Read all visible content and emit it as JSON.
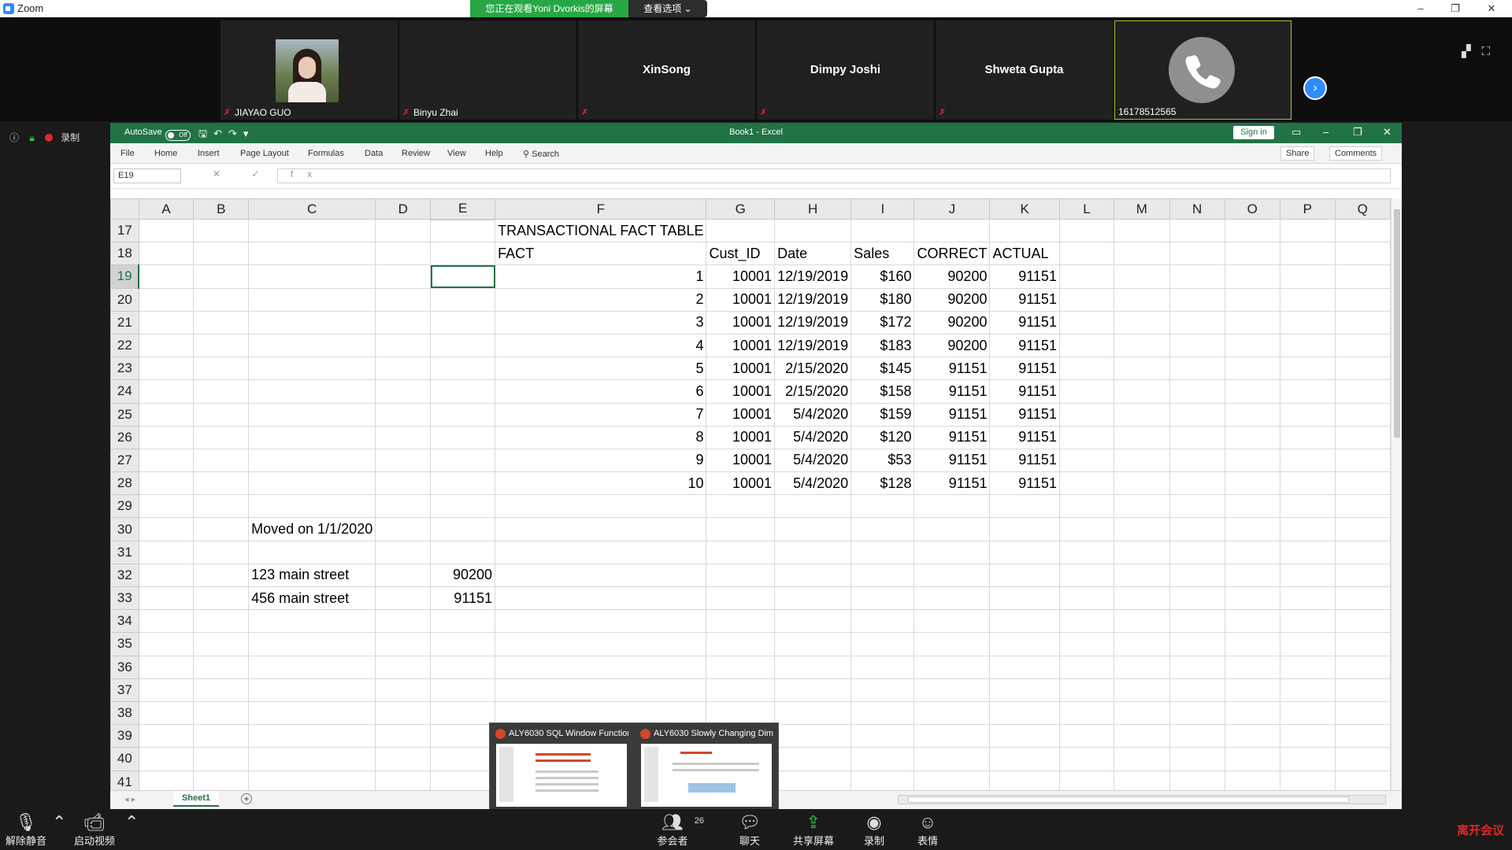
{
  "zoom": {
    "title": "Zoom",
    "share_banner": "您正在观看Yoni Dvorkis的屏幕",
    "view_options": "查看选项 ⌄",
    "win_min": "–",
    "win_restore": "❐",
    "win_close": "✕",
    "participants": [
      {
        "name": "JIAYAO GUO",
        "center_name": ""
      },
      {
        "name": "Binyu Zhai",
        "center_name": ""
      },
      {
        "name": "",
        "center_name": "XinSong"
      },
      {
        "name": "",
        "center_name": "Dimpy Joshi"
      },
      {
        "name": "",
        "center_name": "Shweta Gupta"
      },
      {
        "name": "16178512565",
        "center_name": ""
      }
    ],
    "record_label": "录制",
    "toolbar": {
      "unmute": "解除静音",
      "start_video": "启动视频",
      "participants": "参会者",
      "participant_count": "26",
      "chat": "聊天",
      "share_screen": "共享屏幕",
      "record": "录制",
      "reactions": "表情",
      "leave": "离开会议"
    }
  },
  "excel": {
    "autosave_label": "AutoSave",
    "autosave_state": "Off",
    "book_title": "Book1  -  Excel",
    "sign_in": "Sign in",
    "ribbon_tabs": [
      "File",
      "Home",
      "Insert",
      "Page Layout",
      "Formulas",
      "Data",
      "Review",
      "View",
      "Help"
    ],
    "search": "Search",
    "share": "Share",
    "comments": "Comments",
    "name_box": "E19",
    "formula_icons": "✕ ✓ fx",
    "sheet_tab": "Sheet1",
    "columns": [
      "A",
      "B",
      "C",
      "D",
      "E",
      "F",
      "G",
      "H",
      "I",
      "J",
      "K",
      "L",
      "M",
      "N",
      "O",
      "P",
      "Q"
    ],
    "selected_cell": "E19",
    "rows": [
      {
        "n": "17",
        "F": "TRANSACTIONAL FACT TABLE"
      },
      {
        "n": "18",
        "F": "FACT",
        "G": "Cust_ID",
        "H": "Date",
        "I": "Sales",
        "J": "CORRECT",
        "K": "ACTUAL"
      },
      {
        "n": "19",
        "F": "1",
        "G": "10001",
        "H": "12/19/2019",
        "I": "$160",
        "J": "90200",
        "K": "91151"
      },
      {
        "n": "20",
        "F": "2",
        "G": "10001",
        "H": "12/19/2019",
        "I": "$180",
        "J": "90200",
        "K": "91151"
      },
      {
        "n": "21",
        "F": "3",
        "G": "10001",
        "H": "12/19/2019",
        "I": "$172",
        "J": "90200",
        "K": "91151"
      },
      {
        "n": "22",
        "F": "4",
        "G": "10001",
        "H": "12/19/2019",
        "I": "$183",
        "J": "90200",
        "K": "91151"
      },
      {
        "n": "23",
        "F": "5",
        "G": "10001",
        "H": "2/15/2020",
        "I": "$145",
        "J": "91151",
        "K": "91151"
      },
      {
        "n": "24",
        "F": "6",
        "G": "10001",
        "H": "2/15/2020",
        "I": "$158",
        "J": "91151",
        "K": "91151"
      },
      {
        "n": "25",
        "F": "7",
        "G": "10001",
        "H": "5/4/2020",
        "I": "$159",
        "J": "91151",
        "K": "91151"
      },
      {
        "n": "26",
        "F": "8",
        "G": "10001",
        "H": "5/4/2020",
        "I": "$120",
        "J": "91151",
        "K": "91151"
      },
      {
        "n": "27",
        "F": "9",
        "G": "10001",
        "H": "5/4/2020",
        "I": "$53",
        "J": "91151",
        "K": "91151"
      },
      {
        "n": "28",
        "F": "10",
        "G": "10001",
        "H": "5/4/2020",
        "I": "$128",
        "J": "91151",
        "K": "91151"
      },
      {
        "n": "29"
      },
      {
        "n": "30",
        "C": "Moved on 1/1/2020"
      },
      {
        "n": "31"
      },
      {
        "n": "32",
        "C": "123 main street",
        "E": "90200"
      },
      {
        "n": "33",
        "C": "456 main street",
        "E": "91151"
      },
      {
        "n": "34"
      },
      {
        "n": "35"
      },
      {
        "n": "36"
      },
      {
        "n": "37"
      },
      {
        "n": "38"
      },
      {
        "n": "39"
      },
      {
        "n": "40"
      },
      {
        "n": "41"
      }
    ]
  },
  "taskbar_previews": [
    {
      "title": "ALY6030 SQL Window Function..."
    },
    {
      "title": "ALY6030 Slowly Changing Dim..."
    }
  ]
}
